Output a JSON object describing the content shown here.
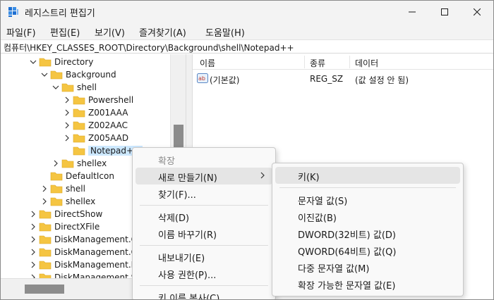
{
  "window": {
    "title": "레지스트리 편집기"
  },
  "menubar": {
    "items": [
      "파일(F)",
      "편집(E)",
      "보기(V)",
      "즐겨찾기(A)",
      "도움말(H)"
    ]
  },
  "address": {
    "path": "컴퓨터\\HKEY_CLASSES_ROOT\\Directory\\Background\\shell\\Notepad++"
  },
  "tree": {
    "rows": [
      {
        "label": "Directory",
        "expanded": true
      },
      {
        "label": "Background",
        "expanded": true
      },
      {
        "label": "shell",
        "expanded": true
      },
      {
        "label": "Powershell",
        "expanded": false
      },
      {
        "label": "Z001AAA",
        "expanded": false
      },
      {
        "label": "Z002AAC",
        "expanded": false
      },
      {
        "label": "Z005AAD",
        "expanded": false
      },
      {
        "label": "Notepad++",
        "expanded": false,
        "selected": true
      },
      {
        "label": "shellex",
        "expanded": false
      },
      {
        "label": "DefaultIcon",
        "expanded": false
      },
      {
        "label": "shell",
        "expanded": false
      },
      {
        "label": "shellex",
        "expanded": false
      },
      {
        "label": "DirectShow",
        "expanded": false
      },
      {
        "label": "DirectXFile",
        "expanded": false
      },
      {
        "label": "DiskManagement.Co",
        "expanded": false
      },
      {
        "label": "DiskManagement.Co",
        "expanded": false
      },
      {
        "label": "DiskManagement.Da",
        "expanded": false
      },
      {
        "label": "DiskManagement.Se",
        "expanded": false
      }
    ]
  },
  "list": {
    "columns": [
      "이름",
      "종류",
      "데이터"
    ],
    "rows": [
      {
        "name": "(기본값)",
        "type": "REG_SZ",
        "data": "(값 설정 안 됨)"
      }
    ]
  },
  "context_menu": {
    "items": [
      "확장",
      "새로 만들기(N)",
      "찾기(F)...",
      "삭제(D)",
      "이름 바꾸기(R)",
      "내보내기(E)",
      "사용 권한(P)...",
      "키 이름 복사(C)"
    ]
  },
  "submenu": {
    "items": [
      "키(K)",
      "문자열 값(S)",
      "이진값(B)",
      "DWORD(32비트) 값(D)",
      "QWORD(64비트) 값(Q)",
      "다중 문자열 값(M)",
      "확장 가능한 문자열 값(E)"
    ]
  },
  "colors": {
    "folder": "#f5c542",
    "selection": "#cce8ff",
    "menu_hover": "#e5e5e5"
  }
}
